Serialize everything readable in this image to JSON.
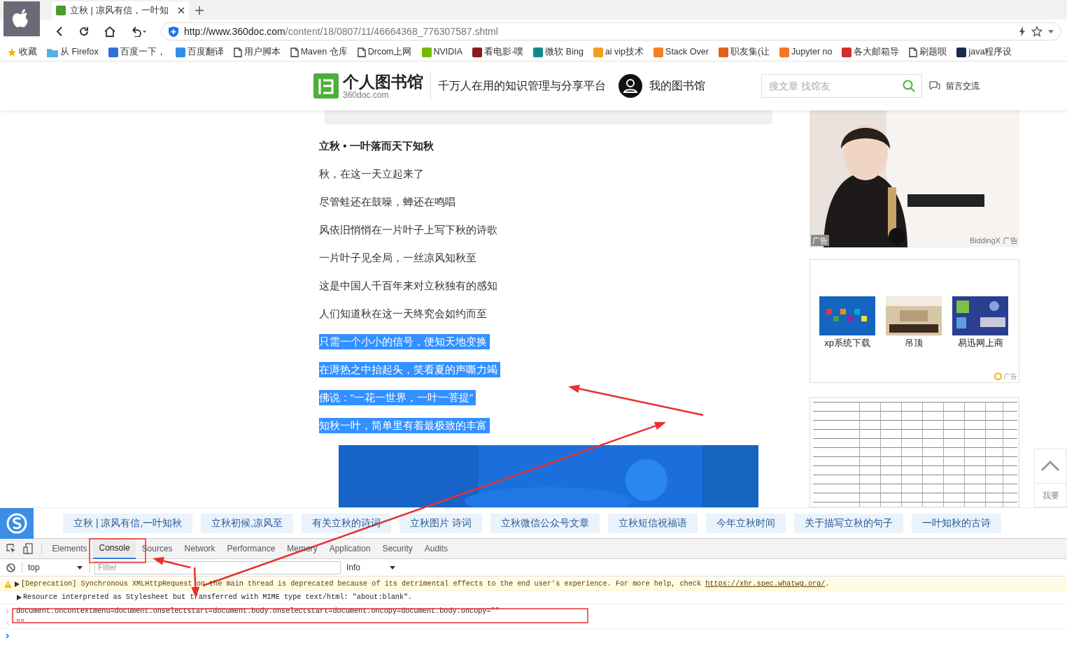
{
  "browser": {
    "tabs": [
      {
        "title": "立秋 | 凉风有信，一叶知",
        "selected": true
      }
    ],
    "url_host": "http://www.360doc.com",
    "url_path": "/content/18/0807/11/46664368_776307587.shtml",
    "bookmarks": [
      {
        "label": "收藏",
        "kind": "star",
        "color": "#f5b400"
      },
      {
        "label": "从 Firefox",
        "kind": "folder",
        "color": "#5aaee8"
      },
      {
        "label": "百度一下，",
        "kind": "site",
        "color": "#2f6fdc"
      },
      {
        "label": "百度翻译",
        "kind": "site",
        "color": "#2f8fe8"
      },
      {
        "label": "用户脚本",
        "kind": "page",
        "color": "#666666"
      },
      {
        "label": "Maven 仓库",
        "kind": "page",
        "color": "#666666"
      },
      {
        "label": "Drcom上网",
        "kind": "page",
        "color": "#666666"
      },
      {
        "label": "NVIDIA",
        "kind": "site",
        "color": "#76b900"
      },
      {
        "label": "看电影-噗",
        "kind": "site",
        "color": "#8b1a1a"
      },
      {
        "label": "微软 Bing",
        "kind": "site",
        "color": "#138a8a"
      },
      {
        "label": "ai vip技术",
        "kind": "site",
        "color": "#f0a020"
      },
      {
        "label": "Stack Over",
        "kind": "site",
        "color": "#f48024"
      },
      {
        "label": "职友集(让",
        "kind": "site",
        "color": "#e06020"
      },
      {
        "label": "Jupyter no",
        "kind": "site",
        "color": "#f37726"
      },
      {
        "label": "各大邮箱导",
        "kind": "site",
        "color": "#d03030"
      },
      {
        "label": "刷题呗",
        "kind": "page",
        "color": "#666666"
      },
      {
        "label": "java程序设",
        "kind": "site",
        "color": "#1a2a4a"
      }
    ]
  },
  "site_header": {
    "logo_name": "个人图书馆",
    "logo_domain": "360doc.com",
    "slogan": "千万人在用的知识管理与分享平台",
    "my_library": "我的图书馆",
    "search": {
      "placeholder": "搜文章 找馆友"
    },
    "message": "留言交流"
  },
  "article": {
    "title": "立秋 • 一叶落而天下知秋",
    "lines": [
      {
        "text": "秋，在这一天立起来了",
        "selected": false
      },
      {
        "text": "尽管蛙还在鼓噪，蝉还在鸣唱",
        "selected": false
      },
      {
        "text": "风依旧悄悄在一片叶子上写下秋的诗歌",
        "selected": false
      },
      {
        "text": "一片叶子见全局，一丝凉风知秋至",
        "selected": false
      },
      {
        "text": "这是中国人千百年来对立秋独有的感知",
        "selected": false
      },
      {
        "text": "人们知道秋在这一天终究会如约而至",
        "selected": false
      },
      {
        "text": "只需一个小小的信号，便知天地变换",
        "selected": true
      },
      {
        "text": "在溽热之中抬起头，笑看夏的声嘶力竭",
        "selected": true
      },
      {
        "text": "佛说：“一花一世界，一叶一菩提”",
        "selected": true
      },
      {
        "text": "知秋一叶，简单里有着最极致的丰富",
        "selected": true
      }
    ]
  },
  "sidebar": {
    "ad_label": "广告",
    "ad_source": "BiddingX",
    "ad_source_label": "广告",
    "ad_links": [
      {
        "label": "xp系统下载"
      },
      {
        "label": "吊顶"
      },
      {
        "label": "易迅网上商"
      }
    ],
    "ad_links_label": "广告",
    "widget_label": "我要"
  },
  "related_tags": [
    "立秋 | 凉风有信,一叶知秋",
    "立秋初候,凉风至",
    "有关立秋的诗词",
    "立秋图片 诗词",
    "立秋微信公众号文章",
    "立秋短信祝福语",
    "今年立秋时间",
    "关于描写立秋的句子",
    "一叶知秋的古诗"
  ],
  "devtools": {
    "tabs": [
      {
        "label": "Elements",
        "selected": false
      },
      {
        "label": "Console",
        "selected": true
      },
      {
        "label": "Sources",
        "selected": false
      },
      {
        "label": "Network",
        "selected": false
      },
      {
        "label": "Performance",
        "selected": false
      },
      {
        "label": "Memory",
        "selected": false
      },
      {
        "label": "Application",
        "selected": false
      },
      {
        "label": "Security",
        "selected": false
      },
      {
        "label": "Audits",
        "selected": false
      }
    ],
    "context": "top",
    "filter": {
      "placeholder": "Filter"
    },
    "level": "Info",
    "messages": [
      {
        "kind": "warning",
        "text": "[Deprecation] Synchronous XMLHttpRequest on the main thread is deprecated because of its detrimental effects to the end user's experience. For more help, check ",
        "link": "https://xhr.spec.whatwg.org/",
        "tail": "."
      },
      {
        "kind": "log",
        "text": "Resource interpreted as Stylesheet but transferred with MIME type text/html: \"about:blank\"."
      },
      {
        "kind": "input",
        "text": "document.oncontextmenu=document.onselectstart=document.body.onselectstart=document.oncopy=document.body.oncopy=\"\""
      },
      {
        "kind": "result",
        "text": "\"\""
      },
      {
        "kind": "prompt"
      }
    ]
  }
}
